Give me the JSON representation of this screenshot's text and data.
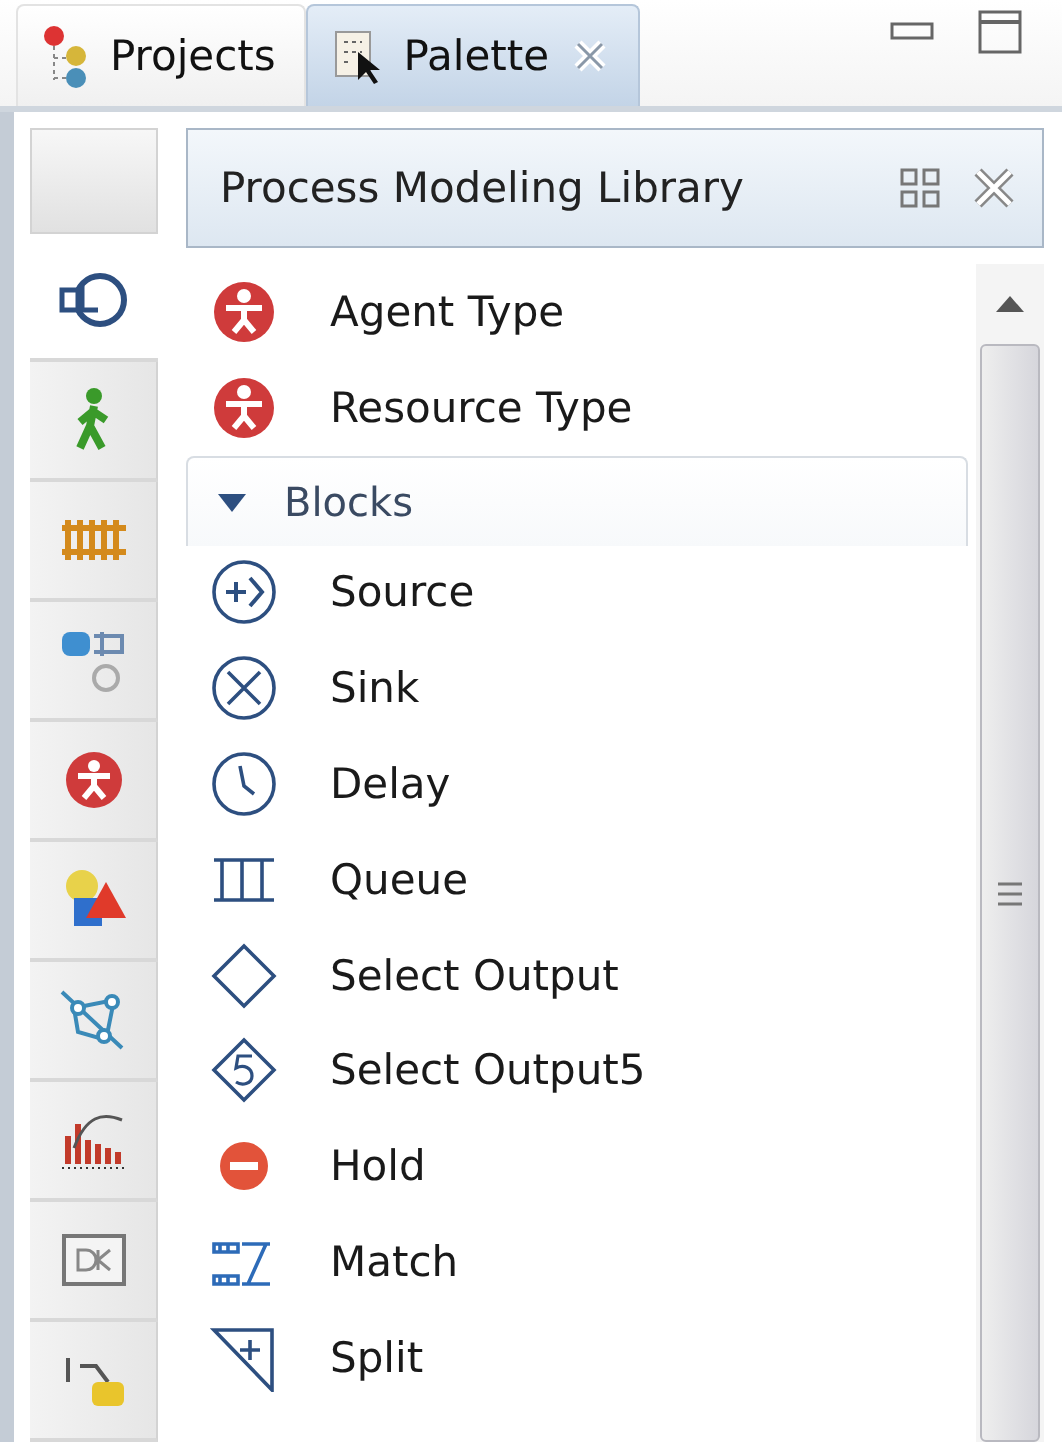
{
  "view_tabs": [
    {
      "label": "Projects",
      "kind": "projects",
      "selected": false,
      "closable": false
    },
    {
      "label": "Palette",
      "kind": "palette",
      "selected": true,
      "closable": true
    }
  ],
  "side_tabs": [
    {
      "kind": "process",
      "selected": true
    },
    {
      "kind": "pedestrian",
      "selected": false
    },
    {
      "kind": "rail",
      "selected": false
    },
    {
      "kind": "fluid",
      "selected": false
    },
    {
      "kind": "agent",
      "selected": false
    },
    {
      "kind": "shapes",
      "selected": false
    },
    {
      "kind": "gis",
      "selected": false
    },
    {
      "kind": "analysis",
      "selected": false
    },
    {
      "kind": "controls",
      "selected": false
    },
    {
      "kind": "connectivity",
      "selected": false
    }
  ],
  "library": {
    "title": "Process Modeling Library",
    "items": [
      {
        "label": "Agent Type",
        "kind": "agent"
      },
      {
        "label": "Resource Type",
        "kind": "agent"
      }
    ],
    "section": {
      "label": "Blocks",
      "expanded": true,
      "items": [
        {
          "label": "Source",
          "kind": "source"
        },
        {
          "label": "Sink",
          "kind": "sink"
        },
        {
          "label": "Delay",
          "kind": "delay"
        },
        {
          "label": "Queue",
          "kind": "queue"
        },
        {
          "label": "Select Output",
          "kind": "select"
        },
        {
          "label": "Select Output5",
          "kind": "select5"
        },
        {
          "label": "Hold",
          "kind": "hold"
        },
        {
          "label": "Match",
          "kind": "match"
        },
        {
          "label": "Split",
          "kind": "split"
        }
      ]
    }
  }
}
